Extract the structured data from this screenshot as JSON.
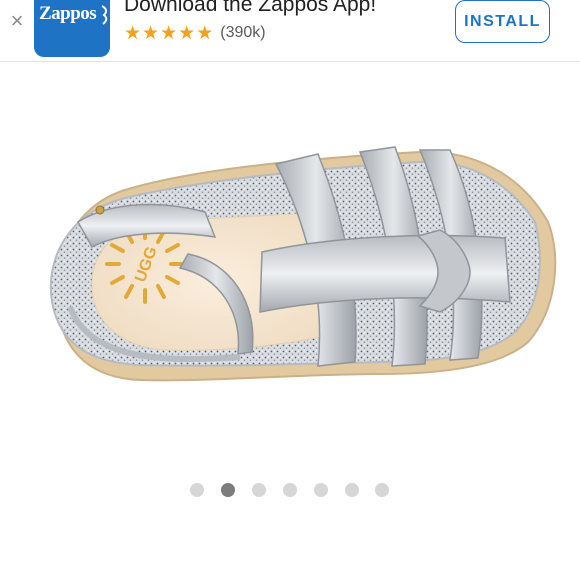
{
  "banner": {
    "close_label": "×",
    "app_logo_text": "Zappos",
    "title": "Download the Zappos App!",
    "rating_stars": 5,
    "star_glyph": "★",
    "rating_count": "(390k)",
    "install_label": "INSTALL"
  },
  "product": {
    "image_icon": "sandal-photo",
    "brand_mark": "UGG"
  },
  "carousel": {
    "total": 7,
    "active_index": 1
  },
  "colors": {
    "brand_blue": "#1f73c4",
    "star": "#f4a21c",
    "dot_active": "#7c7c7c",
    "dot_inactive": "#d6d6d6"
  }
}
